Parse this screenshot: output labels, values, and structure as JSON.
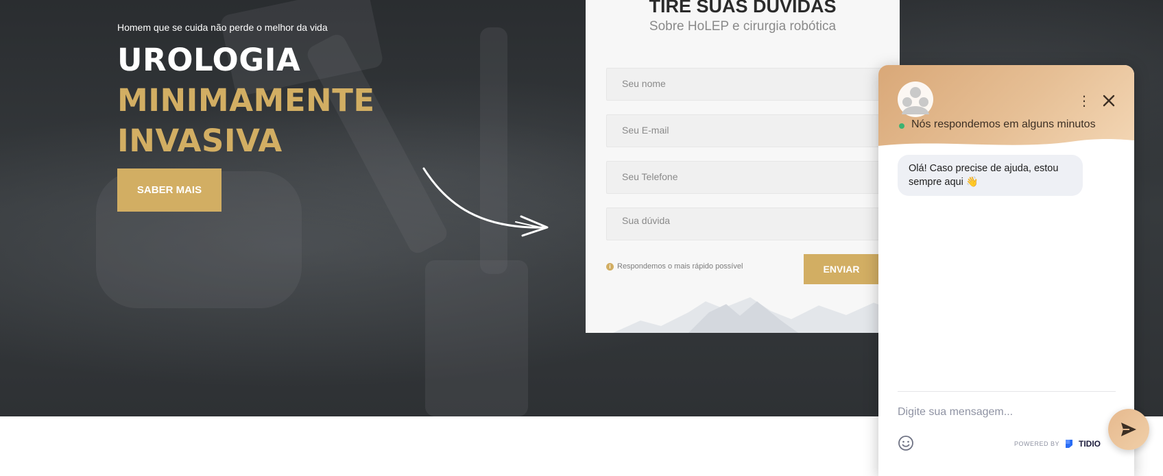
{
  "hero": {
    "kicker": "Homem que se cuida não perde o melhor da vida",
    "title_white": "UROLOGIA",
    "title_gold_1": "MINIMAMENTE",
    "title_gold_2": "INVASIVA",
    "cta_label": "SABER MAIS"
  },
  "form": {
    "title": "TIRE SUAS DÚVIDAS",
    "subtitle": "Sobre HoLEP e cirurgia robótica",
    "fields": {
      "name_placeholder": "Seu nome",
      "email_placeholder": "Seu E-mail",
      "phone_placeholder": "Seu Telefone",
      "question_placeholder": "Sua dúvida"
    },
    "note": "Respondemos o mais rápido possível",
    "submit_label": "ENVIAR"
  },
  "chat": {
    "status": "Nós respondemos em alguns minutos",
    "message": "Olá! Caso precise de ajuda, estou sempre aqui 👋",
    "input_placeholder": "Digite sua mensagem...",
    "powered_by": "POWERED BY",
    "brand": "TIDIO"
  },
  "colors": {
    "accent_gold": "#d2ae63",
    "chat_header": "#e6bf95",
    "hero_dark": "#2e3134"
  },
  "icons": [
    "arrow-icon",
    "info-icon",
    "avatar-icon",
    "more-vertical-icon",
    "close-icon",
    "emoji-icon",
    "tidio-logo-icon",
    "send-icon"
  ]
}
